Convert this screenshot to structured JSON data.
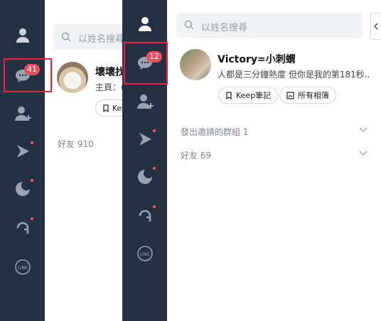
{
  "back": {
    "search_placeholder": "以姓名搜尋",
    "badge": "41",
    "profile_name": "壞壞找",
    "profile_status": "主頁：(",
    "keep_partial": "Kee",
    "friends_section": "好友 910"
  },
  "front": {
    "search_placeholder": "以姓名搜尋",
    "badge": "12",
    "profile_name": "Victory=小刺蝟",
    "profile_status": "人都是三分鐘熱度 但你是我的第181秒...",
    "keep_button": "Keep筆記",
    "album_button": "所有相簿",
    "invited_groups": "發出邀請的群組 1",
    "friends_section": "好友 69"
  },
  "icons": {
    "sidebar": [
      "person-icon",
      "chat-icon",
      "add-friend-icon",
      "play-icon",
      "moon-icon",
      "a-icon",
      "line-icon"
    ]
  },
  "colors": {
    "sidebar": "#253042",
    "badge": "#ee4d5f",
    "highlight": "#e0263a"
  }
}
